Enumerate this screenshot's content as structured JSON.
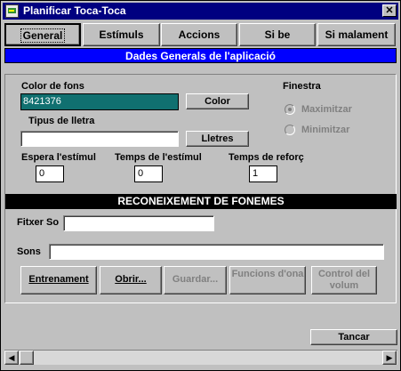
{
  "window": {
    "title": "Planificar Toca-Toca",
    "close_glyph": "✕"
  },
  "tabs": [
    "General",
    "Estímuls",
    "Accions",
    "Si be",
    "Si malament"
  ],
  "banner": "Dades Generals de l'aplicació",
  "general": {
    "color_label": "Color de fons",
    "color_value": "8421376",
    "color_button": "Color",
    "font_label": "Tipus de lletra",
    "font_value": "",
    "font_button": "Lletres",
    "finestra_label": "Finestra",
    "radio_max": "Maximitzar",
    "radio_min": "Minimitzar",
    "espera_label": "Espera l'estímul",
    "espera_value": "0",
    "temps_label": "Temps de l'estímul",
    "temps_value": "0",
    "reforc_label": "Temps de reforç",
    "reforc_value": "1"
  },
  "phonemes": {
    "section_title": "RECONEIXEMENT DE FONEMES",
    "fitxer_label": "Fitxer So",
    "fitxer_value": "",
    "sons_label": "Sons",
    "sons_value": "",
    "buttons": [
      "Entrenament",
      "Obrir...",
      "Guardar...",
      "Funcions d'ona",
      "Control del volum"
    ]
  },
  "footer": {
    "close_button": "Tancar"
  },
  "colors": {
    "title_bar": "#000080",
    "banner": "#0000ff",
    "color_swatch": "#107070",
    "section_bar": "#000000"
  }
}
